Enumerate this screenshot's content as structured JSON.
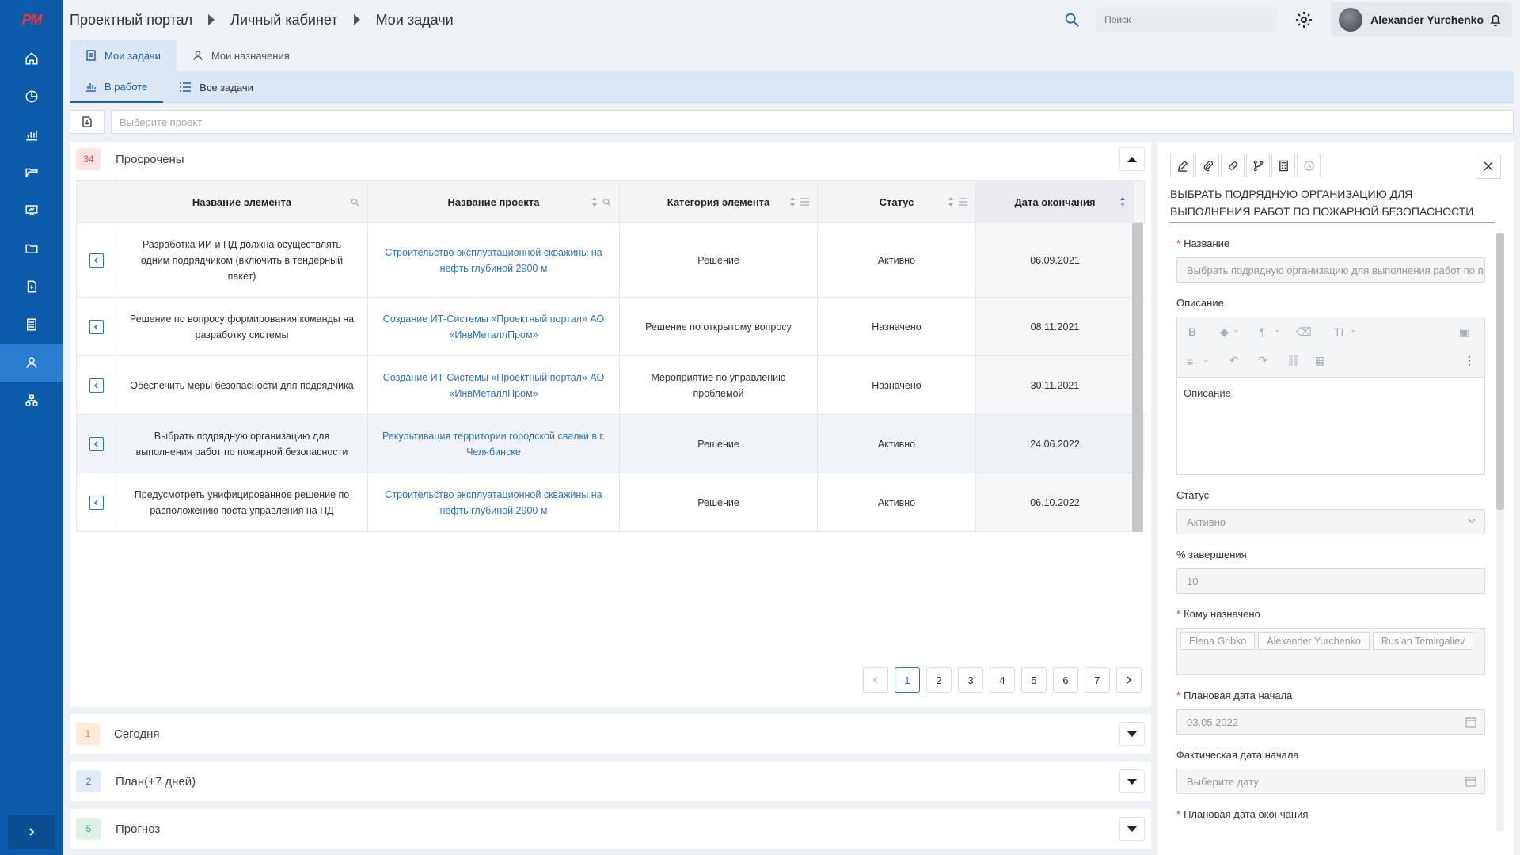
{
  "header": {
    "breadcrumbs": [
      "Проектный портал",
      "Личный кабинет",
      "Мои задачи"
    ],
    "search_placeholder": "Поиск",
    "user_name": "Alexander Yurchenko"
  },
  "sidebar": {
    "logo": "PM",
    "items": [
      {
        "icon": "home-icon"
      },
      {
        "icon": "pie-chart-icon"
      },
      {
        "icon": "bar-chart-icon"
      },
      {
        "icon": "folder-open-icon"
      },
      {
        "icon": "presentation-icon"
      },
      {
        "icon": "folder-icon"
      },
      {
        "icon": "file-add-icon"
      },
      {
        "icon": "list-icon"
      },
      {
        "icon": "user-icon",
        "active": true
      },
      {
        "icon": "org-chart-icon"
      }
    ]
  },
  "tabs": [
    {
      "label": "Мои задачи",
      "active": true
    },
    {
      "label": "Мои назначения",
      "active": false
    }
  ],
  "subtabs": [
    {
      "label": "В работе",
      "active": true
    },
    {
      "label": "Все задачи",
      "active": false
    }
  ],
  "project_filter": {
    "placeholder": "Выберите проект"
  },
  "overdue": {
    "count": "34",
    "title": "Просрочены",
    "columns": [
      "Название элемента",
      "Название проекта",
      "Категория элемента",
      "Статус",
      "Дата окончания"
    ],
    "rows": [
      {
        "name": "Разработка ИИ и ПД должна осуществлять одним подрядчиком (включить в тендерный пакет)",
        "project": "Строительство эксплуатационной скважины на нефть глубиной 2900 м",
        "category": "Решение",
        "status": "Активно",
        "date": "06.09.2021"
      },
      {
        "name": "Решение по вопросу формирования команды на разработку системы",
        "project": "Создание ИТ-Системы «Проектный портал» АО «ИнвМеталлПром»",
        "category": "Решение по открытому вопросу",
        "status": "Назначено",
        "date": "08.11.2021"
      },
      {
        "name": "Обеспечить меры безопасности для подрядчика",
        "project": "Создание ИТ-Системы «Проектный портал» АО «ИнвМеталлПром»",
        "category": "Мероприятие по управлению проблемой",
        "status": "Назначено",
        "date": "30.11.2021"
      },
      {
        "name": "Выбрать подрядную организацию для выполнения работ по пожарной безопасности",
        "project": "Рекультивация территории городской свалки в г. Челябинске",
        "category": "Решение",
        "status": "Активно",
        "date": "24.06.2022"
      },
      {
        "name": "Предусмотреть унифицированное решение по расположению поста управления на ПД",
        "project": "Строительство эксплуатационной скважины на нефть глубиной 2900 м",
        "category": "Решение",
        "status": "Активно",
        "date": "06.10.2022"
      }
    ],
    "pages": [
      "1",
      "2",
      "3",
      "4",
      "5",
      "6",
      "7"
    ],
    "current_page": "1"
  },
  "sections": [
    {
      "count": "1",
      "title": "Сегодня",
      "color": "orange"
    },
    {
      "count": "2",
      "title": "План(+7 дней)",
      "color": "blue"
    },
    {
      "count": "5",
      "title": "Прогноз",
      "color": "green"
    }
  ],
  "detail": {
    "title": "ВЫБРАТЬ ПОДРЯДНУЮ ОРГАНИЗАЦИЮ ДЛЯ ВЫПОЛНЕНИЯ РАБОТ ПО ПОЖАРНОЙ БЕЗОПАСНОСТИ",
    "name_label": "Название",
    "name_value": "Выбрать подрядную организацию для выполнения работ по пожарной безопасности",
    "desc_label": "Описание",
    "desc_placeholder": "Описание",
    "status_label": "Статус",
    "status_value": "Активно",
    "percent_label": "% завершения",
    "percent_value": "10",
    "assignees_label": "Кому назначено",
    "assignees": [
      "Elena Gribko",
      "Alexander Yurchenko",
      "Ruslan Temirgaliev"
    ],
    "plan_start_label": "Плановая дата начала",
    "plan_start_value": "03.05.2022",
    "fact_start_label": "Фактическая дата начала",
    "fact_start_placeholder": "Выберите дату",
    "plan_end_label": "Плановая дата окончания"
  },
  "colors": {
    "sidebar": "#0b5ba8",
    "accent": "#2e73c0",
    "active_tab_bg": "#dbe7f4"
  }
}
